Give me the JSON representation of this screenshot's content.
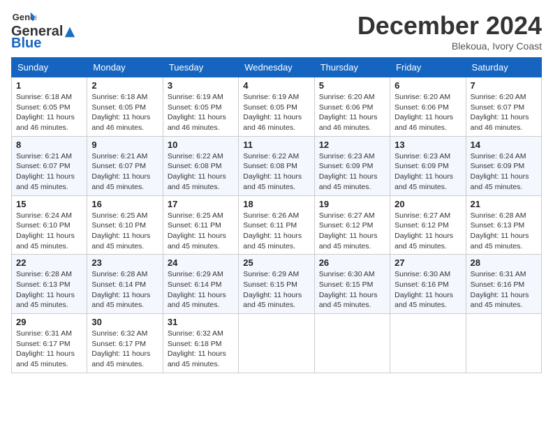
{
  "header": {
    "logo_general": "General",
    "logo_blue": "Blue",
    "month_title": "December 2024",
    "location": "Blekoua, Ivory Coast"
  },
  "weekdays": [
    "Sunday",
    "Monday",
    "Tuesday",
    "Wednesday",
    "Thursday",
    "Friday",
    "Saturday"
  ],
  "weeks": [
    [
      {
        "day": "1",
        "sunrise": "Sunrise: 6:18 AM",
        "sunset": "Sunset: 6:05 PM",
        "daylight": "Daylight: 11 hours and 46 minutes."
      },
      {
        "day": "2",
        "sunrise": "Sunrise: 6:18 AM",
        "sunset": "Sunset: 6:05 PM",
        "daylight": "Daylight: 11 hours and 46 minutes."
      },
      {
        "day": "3",
        "sunrise": "Sunrise: 6:19 AM",
        "sunset": "Sunset: 6:05 PM",
        "daylight": "Daylight: 11 hours and 46 minutes."
      },
      {
        "day": "4",
        "sunrise": "Sunrise: 6:19 AM",
        "sunset": "Sunset: 6:05 PM",
        "daylight": "Daylight: 11 hours and 46 minutes."
      },
      {
        "day": "5",
        "sunrise": "Sunrise: 6:20 AM",
        "sunset": "Sunset: 6:06 PM",
        "daylight": "Daylight: 11 hours and 46 minutes."
      },
      {
        "day": "6",
        "sunrise": "Sunrise: 6:20 AM",
        "sunset": "Sunset: 6:06 PM",
        "daylight": "Daylight: 11 hours and 46 minutes."
      },
      {
        "day": "7",
        "sunrise": "Sunrise: 6:20 AM",
        "sunset": "Sunset: 6:07 PM",
        "daylight": "Daylight: 11 hours and 46 minutes."
      }
    ],
    [
      {
        "day": "8",
        "sunrise": "Sunrise: 6:21 AM",
        "sunset": "Sunset: 6:07 PM",
        "daylight": "Daylight: 11 hours and 45 minutes."
      },
      {
        "day": "9",
        "sunrise": "Sunrise: 6:21 AM",
        "sunset": "Sunset: 6:07 PM",
        "daylight": "Daylight: 11 hours and 45 minutes."
      },
      {
        "day": "10",
        "sunrise": "Sunrise: 6:22 AM",
        "sunset": "Sunset: 6:08 PM",
        "daylight": "Daylight: 11 hours and 45 minutes."
      },
      {
        "day": "11",
        "sunrise": "Sunrise: 6:22 AM",
        "sunset": "Sunset: 6:08 PM",
        "daylight": "Daylight: 11 hours and 45 minutes."
      },
      {
        "day": "12",
        "sunrise": "Sunrise: 6:23 AM",
        "sunset": "Sunset: 6:09 PM",
        "daylight": "Daylight: 11 hours and 45 minutes."
      },
      {
        "day": "13",
        "sunrise": "Sunrise: 6:23 AM",
        "sunset": "Sunset: 6:09 PM",
        "daylight": "Daylight: 11 hours and 45 minutes."
      },
      {
        "day": "14",
        "sunrise": "Sunrise: 6:24 AM",
        "sunset": "Sunset: 6:09 PM",
        "daylight": "Daylight: 11 hours and 45 minutes."
      }
    ],
    [
      {
        "day": "15",
        "sunrise": "Sunrise: 6:24 AM",
        "sunset": "Sunset: 6:10 PM",
        "daylight": "Daylight: 11 hours and 45 minutes."
      },
      {
        "day": "16",
        "sunrise": "Sunrise: 6:25 AM",
        "sunset": "Sunset: 6:10 PM",
        "daylight": "Daylight: 11 hours and 45 minutes."
      },
      {
        "day": "17",
        "sunrise": "Sunrise: 6:25 AM",
        "sunset": "Sunset: 6:11 PM",
        "daylight": "Daylight: 11 hours and 45 minutes."
      },
      {
        "day": "18",
        "sunrise": "Sunrise: 6:26 AM",
        "sunset": "Sunset: 6:11 PM",
        "daylight": "Daylight: 11 hours and 45 minutes."
      },
      {
        "day": "19",
        "sunrise": "Sunrise: 6:27 AM",
        "sunset": "Sunset: 6:12 PM",
        "daylight": "Daylight: 11 hours and 45 minutes."
      },
      {
        "day": "20",
        "sunrise": "Sunrise: 6:27 AM",
        "sunset": "Sunset: 6:12 PM",
        "daylight": "Daylight: 11 hours and 45 minutes."
      },
      {
        "day": "21",
        "sunrise": "Sunrise: 6:28 AM",
        "sunset": "Sunset: 6:13 PM",
        "daylight": "Daylight: 11 hours and 45 minutes."
      }
    ],
    [
      {
        "day": "22",
        "sunrise": "Sunrise: 6:28 AM",
        "sunset": "Sunset: 6:13 PM",
        "daylight": "Daylight: 11 hours and 45 minutes."
      },
      {
        "day": "23",
        "sunrise": "Sunrise: 6:28 AM",
        "sunset": "Sunset: 6:14 PM",
        "daylight": "Daylight: 11 hours and 45 minutes."
      },
      {
        "day": "24",
        "sunrise": "Sunrise: 6:29 AM",
        "sunset": "Sunset: 6:14 PM",
        "daylight": "Daylight: 11 hours and 45 minutes."
      },
      {
        "day": "25",
        "sunrise": "Sunrise: 6:29 AM",
        "sunset": "Sunset: 6:15 PM",
        "daylight": "Daylight: 11 hours and 45 minutes."
      },
      {
        "day": "26",
        "sunrise": "Sunrise: 6:30 AM",
        "sunset": "Sunset: 6:15 PM",
        "daylight": "Daylight: 11 hours and 45 minutes."
      },
      {
        "day": "27",
        "sunrise": "Sunrise: 6:30 AM",
        "sunset": "Sunset: 6:16 PM",
        "daylight": "Daylight: 11 hours and 45 minutes."
      },
      {
        "day": "28",
        "sunrise": "Sunrise: 6:31 AM",
        "sunset": "Sunset: 6:16 PM",
        "daylight": "Daylight: 11 hours and 45 minutes."
      }
    ],
    [
      {
        "day": "29",
        "sunrise": "Sunrise: 6:31 AM",
        "sunset": "Sunset: 6:17 PM",
        "daylight": "Daylight: 11 hours and 45 minutes."
      },
      {
        "day": "30",
        "sunrise": "Sunrise: 6:32 AM",
        "sunset": "Sunset: 6:17 PM",
        "daylight": "Daylight: 11 hours and 45 minutes."
      },
      {
        "day": "31",
        "sunrise": "Sunrise: 6:32 AM",
        "sunset": "Sunset: 6:18 PM",
        "daylight": "Daylight: 11 hours and 45 minutes."
      },
      null,
      null,
      null,
      null
    ]
  ]
}
